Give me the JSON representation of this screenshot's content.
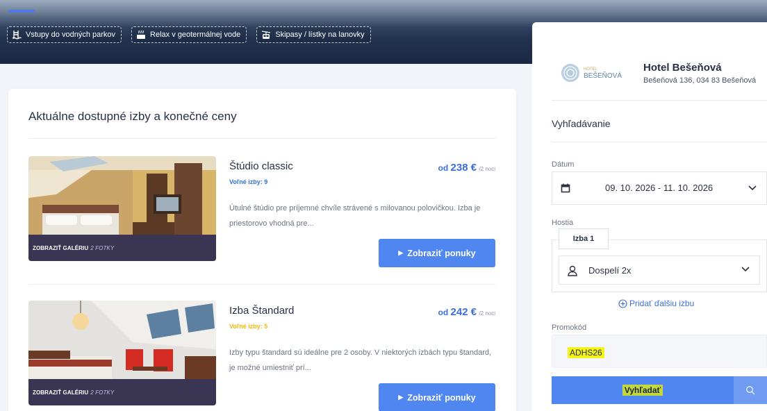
{
  "banner": {
    "chips": [
      {
        "label": "Vstupy do vodných parkov",
        "icon": "pool-ladder-icon"
      },
      {
        "label": "Relax v geotermálnej vode",
        "icon": "thermal-bath-icon"
      },
      {
        "label": "Skipasy / lístky na lanovky",
        "icon": "cable-car-icon"
      }
    ]
  },
  "main": {
    "title": "Aktuálne dostupné izby a konečné ceny",
    "rooms": [
      {
        "name": "Štúdio classic",
        "availability": "Voľné izby: 9",
        "availability_color": "#2f6fd8",
        "price_prefix": "od",
        "price": "238 €",
        "price_unit": "/2 noci",
        "description": "Útulné štúdio pre príjemné chvíle strávené s milovanou polovičkou. Izba je priestorovo vhodná pre...",
        "gallery_label": "ZOBRAZIŤ GALÉRIU",
        "gallery_count": "2 FOTKY",
        "button_label": "Zobraziť ponuky"
      },
      {
        "name": "Izba Štandard",
        "availability": "Voľné izby: 5",
        "availability_color": "#f2b705",
        "price_prefix": "od",
        "price": "242 €",
        "price_unit": "/2 noci",
        "description": "Izby typu štandard sú ideálne pre 2 osoby. V niektorých izbách typu štandard, je možné umiestniť prí...",
        "gallery_label": "ZOBRAZIŤ GALÉRIU",
        "gallery_count": "2 FOTKY",
        "button_label": "Zobraziť ponuky"
      }
    ]
  },
  "sidebar": {
    "logo_small": "HOTEL",
    "logo_big": "BEŠEŇOVÁ",
    "hotel_name": "Hotel Bešeňová",
    "hotel_address": "Bešeňová 136, 034 83 Bešeňová",
    "search_title": "Vyhľadávanie",
    "date_label": "Dátum",
    "date_value": "09. 10. 2026 - 11. 10. 2026",
    "guests_label": "Hostia",
    "room_tag": "Izba 1",
    "adults_value": "Dospelí 2x",
    "add_room": "Pridať ďalšiu izbu",
    "promo_label": "Promokód",
    "promo_value": "ADHS26",
    "search_button": "Vyhľadať"
  },
  "colors": {
    "accent": "#4f86ef",
    "link": "#3a6de0",
    "gallery_bar": "#3a3552"
  }
}
